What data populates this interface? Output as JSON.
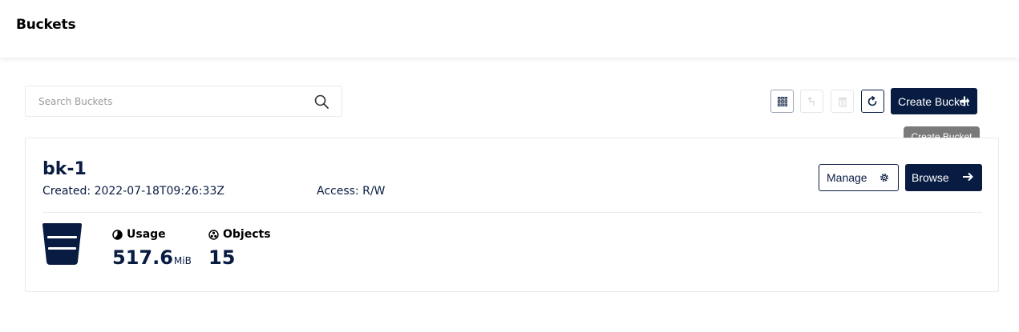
{
  "header": {
    "title": "Buckets"
  },
  "search": {
    "placeholder": "Search Buckets",
    "value": ""
  },
  "toolbar": {
    "icons": [
      "grid-icon",
      "replication-icon",
      "delete-icon",
      "refresh-icon"
    ],
    "create_label": "Create Bucket",
    "create_tooltip": "Create Bucket"
  },
  "bucket": {
    "name": "bk-1",
    "created": "Created: 2022-07-18T09:26:33Z",
    "access": "Access: R/W",
    "manage_label": "Manage",
    "browse_label": "Browse",
    "usage": {
      "label": "Usage",
      "value": "517.6",
      "unit": "MiB"
    },
    "objects": {
      "label": "Objects",
      "value": "15"
    }
  },
  "colors": {
    "primary": "#081c42",
    "tooltip": "#7a7a7a",
    "border": "#eaeaea"
  }
}
